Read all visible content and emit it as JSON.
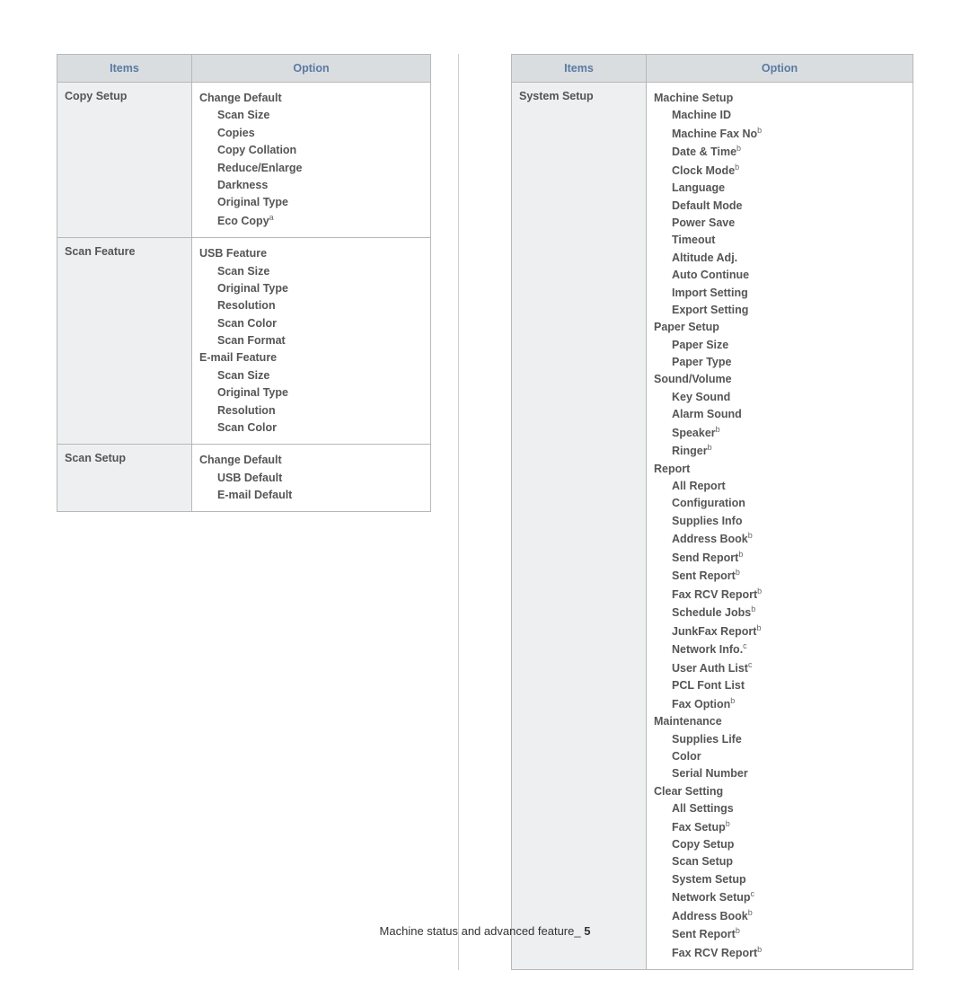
{
  "headers": {
    "items": "Items",
    "option": "Option"
  },
  "left": [
    {
      "item": "Copy Setup",
      "options": [
        {
          "text": "Change Default",
          "cls": "bold"
        },
        {
          "text": "Scan Size",
          "cls": "indent"
        },
        {
          "text": "Copies",
          "cls": "indent"
        },
        {
          "text": "Copy Collation",
          "cls": "indent"
        },
        {
          "text": "Reduce/Enlarge",
          "cls": "indent"
        },
        {
          "text": "Darkness",
          "cls": "indent"
        },
        {
          "text": "Original Type",
          "cls": "indent"
        },
        {
          "text": "Eco Copy",
          "cls": "indent",
          "sup": "a"
        }
      ]
    },
    {
      "item": "Scan Feature",
      "options": [
        {
          "text": "USB Feature",
          "cls": "bold"
        },
        {
          "text": "Scan Size",
          "cls": "indent"
        },
        {
          "text": "Original Type",
          "cls": "indent"
        },
        {
          "text": "Resolution",
          "cls": "indent"
        },
        {
          "text": "Scan Color",
          "cls": "indent"
        },
        {
          "text": "Scan Format",
          "cls": "indent"
        },
        {
          "text": "E-mail Feature",
          "cls": "bold"
        },
        {
          "text": "Scan Size",
          "cls": "indent"
        },
        {
          "text": "Original Type",
          "cls": "indent"
        },
        {
          "text": "Resolution",
          "cls": "indent"
        },
        {
          "text": "Scan Color",
          "cls": "indent"
        }
      ]
    },
    {
      "item": "Scan Setup",
      "options": [
        {
          "text": "Change Default",
          "cls": "bold"
        },
        {
          "text": "USB Default",
          "cls": "indent"
        },
        {
          "text": "E-mail Default",
          "cls": "indent"
        }
      ]
    }
  ],
  "right": [
    {
      "item": "System Setup",
      "options": [
        {
          "text": "Machine Setup",
          "cls": "bold"
        },
        {
          "text": "Machine ID",
          "cls": "indent"
        },
        {
          "text": "Machine Fax No",
          "cls": "indent",
          "sup": "b"
        },
        {
          "text": "Date & Time",
          "cls": "indent",
          "sup": "b"
        },
        {
          "text": "Clock Mode",
          "cls": "indent",
          "sup": "b"
        },
        {
          "text": "Language",
          "cls": "indent"
        },
        {
          "text": "Default Mode",
          "cls": "indent"
        },
        {
          "text": "Power Save",
          "cls": "indent"
        },
        {
          "text": "Timeout",
          "cls": "indent"
        },
        {
          "text": "Altitude Adj.",
          "cls": "indent"
        },
        {
          "text": "Auto Continue",
          "cls": "indent"
        },
        {
          "text": "Import Setting",
          "cls": "indent"
        },
        {
          "text": "Export Setting",
          "cls": "indent"
        },
        {
          "text": "Paper Setup",
          "cls": "bold"
        },
        {
          "text": "Paper Size",
          "cls": "indent"
        },
        {
          "text": "Paper Type",
          "cls": "indent"
        },
        {
          "text": "Sound/Volume",
          "cls": "bold"
        },
        {
          "text": "Key Sound",
          "cls": "indent"
        },
        {
          "text": "Alarm Sound",
          "cls": "indent"
        },
        {
          "text": "Speaker",
          "cls": "indent",
          "sup": "b"
        },
        {
          "text": "Ringer",
          "cls": "indent",
          "sup": "b"
        },
        {
          "text": "Report",
          "cls": "bold"
        },
        {
          "text": "All Report",
          "cls": "indent"
        },
        {
          "text": "Configuration",
          "cls": "indent"
        },
        {
          "text": "Supplies Info",
          "cls": "indent"
        },
        {
          "text": "Address Book",
          "cls": "indent",
          "sup": "b"
        },
        {
          "text": "Send Report",
          "cls": "indent",
          "sup": "b"
        },
        {
          "text": "Sent Report",
          "cls": "indent",
          "sup": "b"
        },
        {
          "text": "Fax RCV Report",
          "cls": "indent",
          "sup": "b"
        },
        {
          "text": "Schedule Jobs",
          "cls": "indent",
          "sup": "b"
        },
        {
          "text": "JunkFax Report",
          "cls": "indent",
          "sup": "b"
        },
        {
          "text": "Network Info.",
          "cls": "indent",
          "sup": "c"
        },
        {
          "text": "User Auth List",
          "cls": "indent",
          "sup": "c"
        },
        {
          "text": "PCL Font List",
          "cls": "indent"
        },
        {
          "text": "Fax Option",
          "cls": "indent",
          "sup": "b"
        },
        {
          "text": "Maintenance",
          "cls": "bold"
        },
        {
          "text": "Supplies Life",
          "cls": "indent"
        },
        {
          "text": "Color",
          "cls": "indent"
        },
        {
          "text": "Serial Number",
          "cls": "indent"
        },
        {
          "text": "Clear Setting",
          "cls": "bold"
        },
        {
          "text": "All Settings",
          "cls": "indent"
        },
        {
          "text": "Fax Setup",
          "cls": "indent",
          "sup": "b"
        },
        {
          "text": "Copy Setup",
          "cls": "indent"
        },
        {
          "text": "Scan Setup",
          "cls": "indent"
        },
        {
          "text": "System Setup",
          "cls": "indent"
        },
        {
          "text": "Network Setup",
          "cls": "indent",
          "sup": "c"
        },
        {
          "text": "Address Book",
          "cls": "indent",
          "sup": "b"
        },
        {
          "text": "Sent Report",
          "cls": "indent",
          "sup": "b"
        },
        {
          "text": "Fax RCV Report",
          "cls": "indent",
          "sup": "b"
        }
      ]
    }
  ],
  "footer": {
    "text": "Machine status and advanced feature_ ",
    "page": "5"
  }
}
